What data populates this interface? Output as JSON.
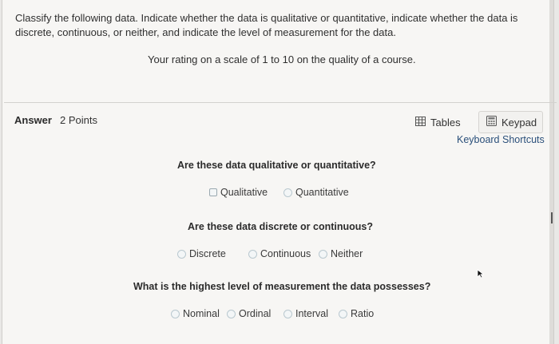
{
  "question": {
    "text": "Classify the following data. Indicate whether the data is qualitative or quantitative, indicate whether the data is discrete, continuous, or neither, and indicate the level of measurement for the data.",
    "prompt": "Your rating on a scale of 1 to 10 on the quality of a course."
  },
  "answer": {
    "label": "Answer",
    "points": "2 Points"
  },
  "toolbar": {
    "tables_label": "Tables",
    "keypad_label": "Keypad",
    "shortcuts_label": "Keyboard Shortcuts"
  },
  "parts": [
    {
      "title": "Are these data qualitative or quantitative?",
      "options": [
        "Qualitative",
        "Quantitative"
      ]
    },
    {
      "title": "Are these data discrete or continuous?",
      "options": [
        "Discrete",
        "Continuous",
        "Neither"
      ]
    },
    {
      "title": "What is the highest level of measurement the data possesses?",
      "options": [
        "Nominal",
        "Ordinal",
        "Interval",
        "Ratio"
      ]
    }
  ],
  "icons": {
    "tables": "table-grid-icon",
    "keypad": "keypad-icon",
    "cursor": "mouse-pointer-icon"
  },
  "colors": {
    "link": "#2a4f7a",
    "radio_border": "#b9c8cf"
  }
}
